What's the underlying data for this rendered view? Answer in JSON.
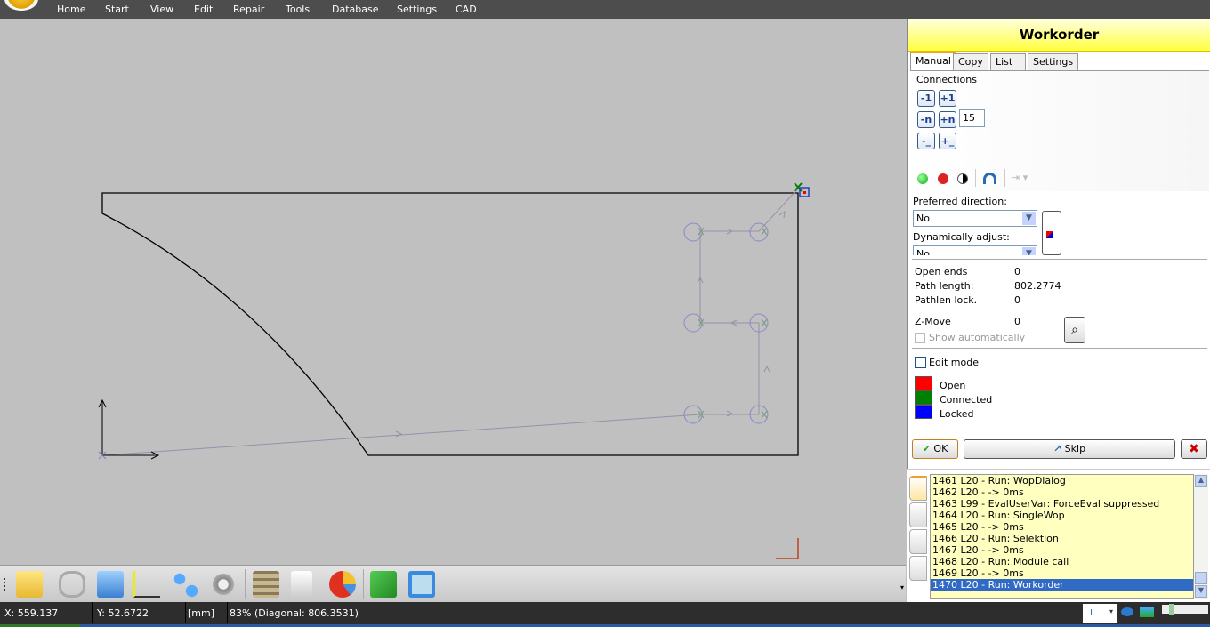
{
  "menu": {
    "items": [
      "Home",
      "Start",
      "View",
      "Edit",
      "Repair",
      "Tools",
      "Database",
      "Settings",
      "CAD"
    ]
  },
  "panel": {
    "title": "Workorder",
    "tabs": [
      "Manual",
      "Copy",
      "List",
      "Settings"
    ],
    "active_tab": "Manual",
    "connections_label": "Connections",
    "buttons": {
      "minus1": "-1",
      "plus1": "+1",
      "minusn": "-n",
      "plusn": "+n",
      "minusall": "-_",
      "plusall": "+_"
    },
    "n_value": "15",
    "preferred_direction_label": "Preferred direction:",
    "preferred_direction_value": "No",
    "dynamically_adjust_label": "Dynamically adjust:",
    "dynamically_adjust_value": "No",
    "stats": [
      {
        "label": "Open ends",
        "value": "0"
      },
      {
        "label": "Path length:",
        "value": "802.2774"
      },
      {
        "label": "Pathlen lock.",
        "value": "0"
      }
    ],
    "zmove_label": "Z-Move",
    "zmove_value": "0",
    "show_auto_label": "Show automatically",
    "show_auto_checked": false,
    "edit_mode_label": "Edit mode",
    "edit_mode_checked": false,
    "legend": [
      {
        "label": "Open",
        "color": "#ff0000"
      },
      {
        "label": "Connected",
        "color": "#008000"
      },
      {
        "label": "Locked",
        "color": "#0000ff"
      }
    ],
    "ok_label": "OK",
    "skip_label": "Skip"
  },
  "log": {
    "lines": [
      "1461 L20 - Run: WopDialog",
      "1462 L20 -  -> 0ms",
      "1463 L99 - EvalUserVar: ForceEval suppressed",
      "1464 L20 - Run: SingleWop",
      "1465 L20 -  -> 0ms",
      "1466 L20 - Run: Selektion",
      "1467 L20 -  -> 0ms",
      "1468 L20 - Run: Module call",
      "1469 L20 -  -> 0ms",
      "1470 L20 - Run: Workorder"
    ],
    "selected_index": 9
  },
  "status": {
    "x": "X: 559.137",
    "y": "Y: 52.6722",
    "unit": "[mm]",
    "zoom": "83% (Diagonal: 806.3531)"
  },
  "toolbar": {
    "icons": [
      "folder-icon",
      "chain-link-icon",
      "3d-box-icon",
      "curve-icon",
      "nodes-icon",
      "gear-icon",
      "film-icon",
      "report-icon",
      "pie-chart-icon",
      "machine-gear-icon",
      "layout-icon"
    ]
  }
}
